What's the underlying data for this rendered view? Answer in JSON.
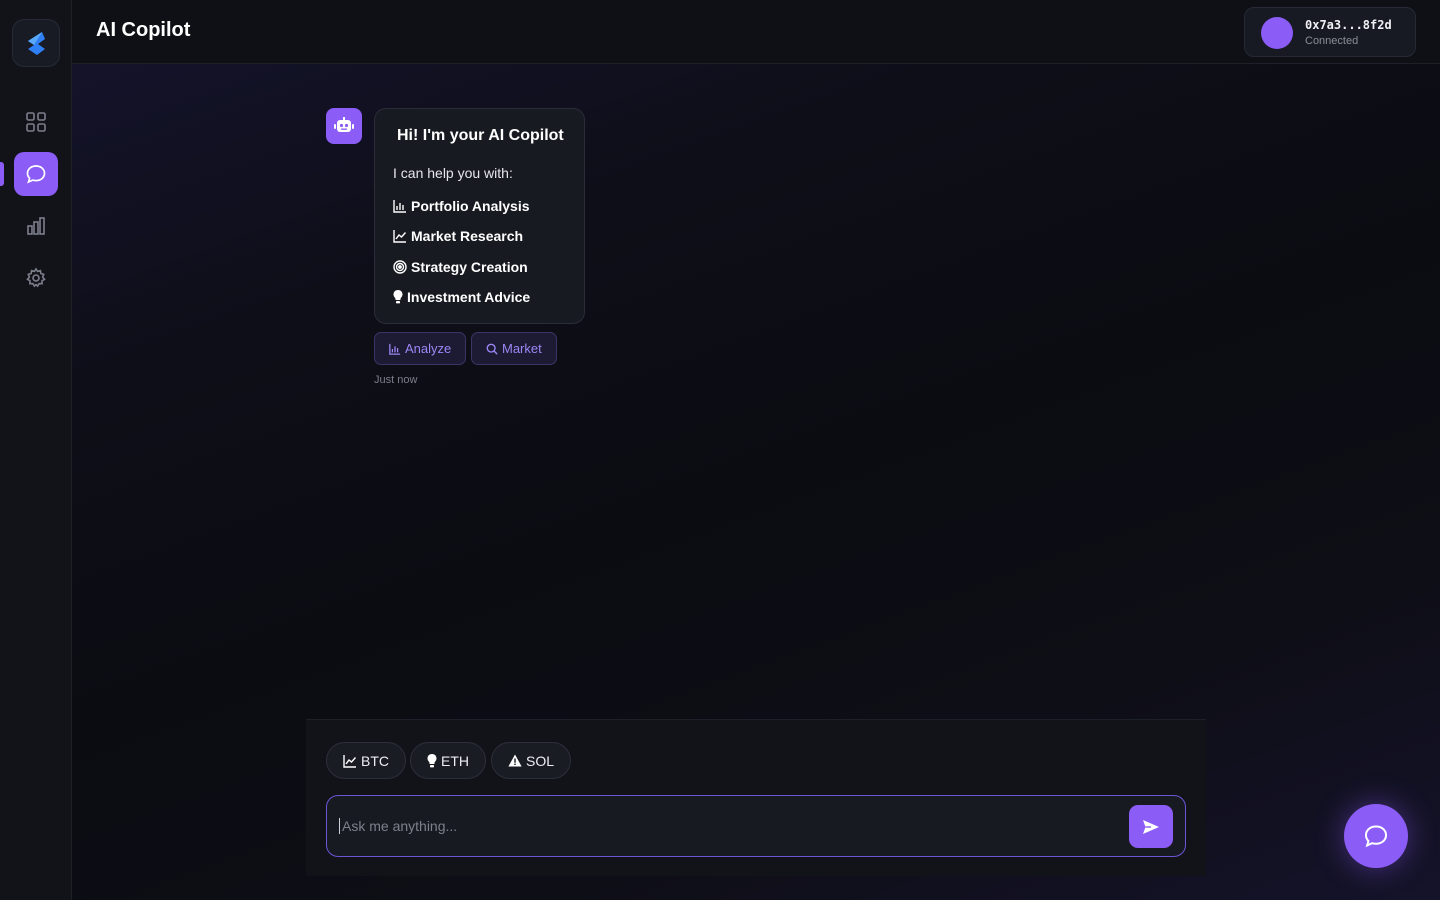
{
  "header": {
    "title": "AI Copilot",
    "wallet_address": "0x7a3...8f2d",
    "wallet_status": "Connected"
  },
  "sidebar": {
    "items": [
      {
        "icon": "grid-icon",
        "label": "Dashboard",
        "active": false
      },
      {
        "icon": "chat-icon",
        "label": "Chat",
        "active": true
      },
      {
        "icon": "bar-chart-icon",
        "label": "Analytics",
        "active": false
      },
      {
        "icon": "gear-icon",
        "label": "Settings",
        "active": false
      }
    ]
  },
  "chat": {
    "message": {
      "title": "Hi! I'm your AI Copilot",
      "intro": "I can help you with:",
      "capabilities": [
        {
          "icon": "bar-chart-icon",
          "label": "Portfolio Analysis"
        },
        {
          "icon": "line-chart-icon",
          "label": "Market Research"
        },
        {
          "icon": "target-icon",
          "label": "Strategy Creation"
        },
        {
          "icon": "lightbulb-icon",
          "label": "Investment Advice"
        }
      ],
      "actions": [
        {
          "icon": "bar-chart-icon",
          "label": "Analyze"
        },
        {
          "icon": "search-icon",
          "label": "Market"
        }
      ],
      "timestamp": "Just now"
    }
  },
  "composer": {
    "chips": [
      {
        "icon": "line-chart-icon",
        "label": "BTC"
      },
      {
        "icon": "lightbulb-icon",
        "label": "ETH"
      },
      {
        "icon": "warning-icon",
        "label": "SOL"
      }
    ],
    "placeholder": "Ask me anything...",
    "value": ""
  },
  "colors": {
    "accent": "#8b5cf6",
    "background": "#0b0c12",
    "surface": "#181a22"
  }
}
